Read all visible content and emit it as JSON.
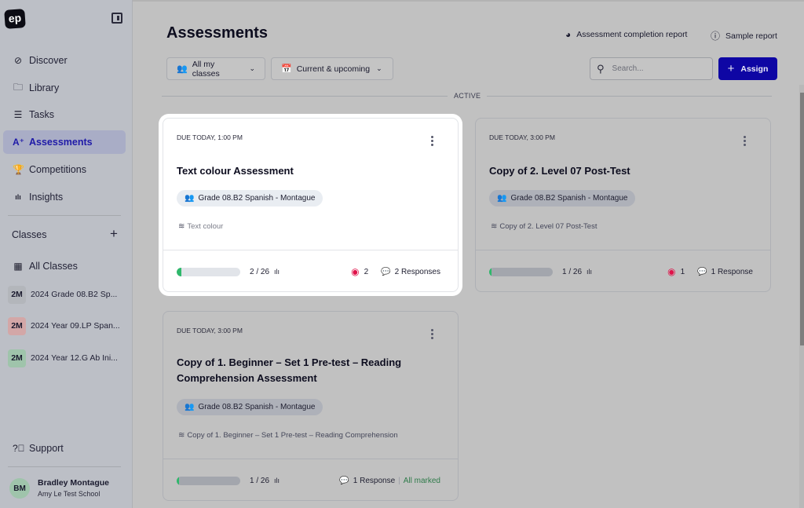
{
  "sidebar": {
    "logo": "ep",
    "nav": [
      {
        "label": "Discover",
        "icon": "compass-icon",
        "glyph": "⊘"
      },
      {
        "label": "Library",
        "icon": "folder-icon",
        "glyph": "🗀"
      },
      {
        "label": "Tasks",
        "icon": "tasks-icon",
        "glyph": "☰"
      },
      {
        "label": "Assessments",
        "icon": "assessment-icon",
        "glyph": "A⁺",
        "active": true
      },
      {
        "label": "Competitions",
        "icon": "trophy-icon",
        "glyph": "🏆"
      },
      {
        "label": "Insights",
        "icon": "bar-chart-icon",
        "glyph": "ılı"
      }
    ],
    "classes_label": "Classes",
    "add_class": "+",
    "all_classes": "All Classes",
    "classes": [
      {
        "badge": "2M",
        "name": "2024 Grade 08.B2 Sp...",
        "color": "#b3b6bb"
      },
      {
        "badge": "2M",
        "name": "2024 Year 09.LP Span...",
        "color": "#d3a7a7"
      },
      {
        "badge": "2M",
        "name": "2024 Year 12.G Ab Ini...",
        "color": "#9fc4ab"
      }
    ],
    "support": "Support",
    "user": {
      "initials": "BM",
      "name": "Bradley Montague",
      "school": "Amy Le Test School"
    }
  },
  "header": {
    "title": "Assessments",
    "completion_report": "Assessment completion report",
    "sample_report": "Sample report",
    "filters": {
      "classes": "All my classes",
      "period": "Current & upcoming"
    },
    "search_placeholder": "Search...",
    "assign_label": "Assign",
    "section_label": "ACTIVE"
  },
  "cards": [
    {
      "due": "DUE TODAY, 1:00 PM",
      "title": "Text colour Assessment",
      "class": "Grade 08.B2 Spanish - Montague",
      "source": "Text colour",
      "completed": "2 / 26",
      "progress": 0.077,
      "views": "2",
      "responses": "2 Responses",
      "highlighted": true
    },
    {
      "due": "DUE TODAY, 3:00 PM",
      "title": "Copy of 2. Level 07 Post-Test",
      "class": "Grade 08.B2 Spanish - Montague",
      "source": "Copy of 2. Level 07 Post-Test",
      "completed": "1 / 26",
      "progress": 0.038,
      "views": "1",
      "responses": "1 Response"
    },
    {
      "due": "DUE TODAY, 3:00 PM",
      "title": "Copy of 1. Beginner – Set 1 Pre-test – Reading Comprehension Assessment",
      "class": "Grade 08.B2 Spanish - Montague",
      "source": "Copy of 1. Beginner – Set 1 Pre-test – Reading Comprehension",
      "completed": "1 / 26",
      "progress": 0.038,
      "responses": "1 Response",
      "status": "All marked"
    }
  ],
  "colors": {
    "accent": "#0e06a4",
    "progress": "#2fb86b",
    "views": "#e0134a",
    "marked": "#2f7b4a"
  }
}
